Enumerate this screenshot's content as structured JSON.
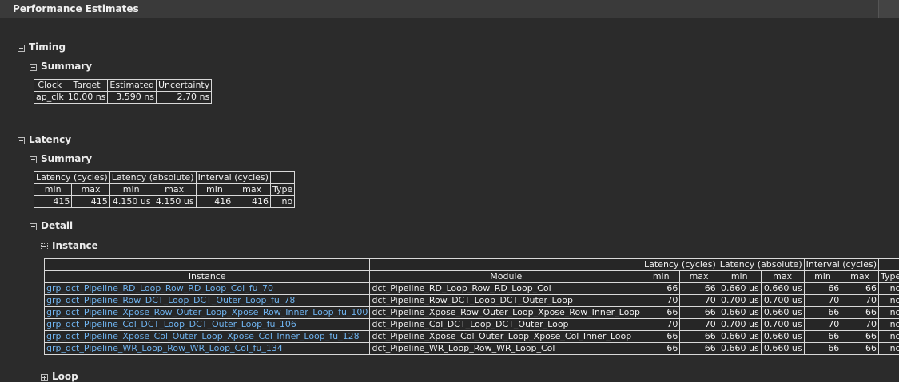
{
  "panel": {
    "title": "Performance Estimates"
  },
  "timing": {
    "heading": "Timing",
    "summary_heading": "Summary",
    "headers": [
      "Clock",
      "Target",
      "Estimated",
      "Uncertainty"
    ],
    "rows": [
      [
        "ap_clk",
        "10.00 ns",
        "3.590 ns",
        "2.70 ns"
      ]
    ]
  },
  "latency": {
    "heading": "Latency",
    "summary_heading": "Summary",
    "group_headers": [
      "Latency (cycles)",
      "Latency (absolute)",
      "Interval (cycles)"
    ],
    "sub_headers": [
      "min",
      "max",
      "min",
      "max",
      "min",
      "max",
      "Type"
    ],
    "row": [
      "415",
      "415",
      "4.150 us",
      "4.150 us",
      "416",
      "416",
      "no"
    ],
    "detail_heading": "Detail",
    "instance_heading": "Instance",
    "instance_table": {
      "group_headers": [
        "Latency (cycles)",
        "Latency (absolute)",
        "Interval (cycles)"
      ],
      "col_headers": [
        "Instance",
        "Module",
        "min",
        "max",
        "min",
        "max",
        "min",
        "max",
        "Type"
      ],
      "rows": [
        [
          "grp_dct_Pipeline_RD_Loop_Row_RD_Loop_Col_fu_70",
          "dct_Pipeline_RD_Loop_Row_RD_Loop_Col",
          "66",
          "66",
          "0.660 us",
          "0.660 us",
          "66",
          "66",
          "no"
        ],
        [
          "grp_dct_Pipeline_Row_DCT_Loop_DCT_Outer_Loop_fu_78",
          "dct_Pipeline_Row_DCT_Loop_DCT_Outer_Loop",
          "70",
          "70",
          "0.700 us",
          "0.700 us",
          "70",
          "70",
          "no"
        ],
        [
          "grp_dct_Pipeline_Xpose_Row_Outer_Loop_Xpose_Row_Inner_Loop_fu_100",
          "dct_Pipeline_Xpose_Row_Outer_Loop_Xpose_Row_Inner_Loop",
          "66",
          "66",
          "0.660 us",
          "0.660 us",
          "66",
          "66",
          "no"
        ],
        [
          "grp_dct_Pipeline_Col_DCT_Loop_DCT_Outer_Loop_fu_106",
          "dct_Pipeline_Col_DCT_Loop_DCT_Outer_Loop",
          "70",
          "70",
          "0.700 us",
          "0.700 us",
          "70",
          "70",
          "no"
        ],
        [
          "grp_dct_Pipeline_Xpose_Col_Outer_Loop_Xpose_Col_Inner_Loop_fu_128",
          "dct_Pipeline_Xpose_Col_Outer_Loop_Xpose_Col_Inner_Loop",
          "66",
          "66",
          "0.660 us",
          "0.660 us",
          "66",
          "66",
          "no"
        ],
        [
          "grp_dct_Pipeline_WR_Loop_Row_WR_Loop_Col_fu_134",
          "dct_Pipeline_WR_Loop_Row_WR_Loop_Col",
          "66",
          "66",
          "0.660 us",
          "0.660 us",
          "66",
          "66",
          "no"
        ]
      ]
    },
    "loop_heading": "Loop"
  }
}
